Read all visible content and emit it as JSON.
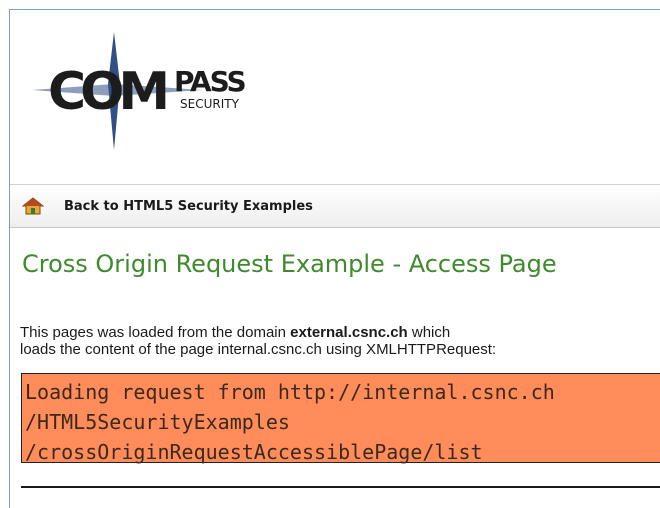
{
  "header": {
    "logo": {
      "word": "COM",
      "pass": "PASS",
      "security": "SECURITY",
      "icon": "compass-star-logo"
    }
  },
  "nav": {
    "home_icon": "home-icon",
    "back_label": "Back to HTML5 Security Examples"
  },
  "main": {
    "title": "Cross Origin Request Example - Access Page",
    "description": {
      "part1": "This pages was loaded from the domain ",
      "domain": "external.csnc.ch",
      "part2": " which",
      "line2": "loads the content of the page internal.csnc.ch using XMLHTTPRequest:"
    },
    "output_lines": [
      "Loading request from http://internal.csnc.ch",
      "/HTML5SecurityExamples",
      "/crossOriginRequestAccessiblePage/list"
    ]
  },
  "colors": {
    "title": "#3f8a2d",
    "output_bg": "#ff8c5a",
    "frame_border": "#7aa0c9"
  }
}
